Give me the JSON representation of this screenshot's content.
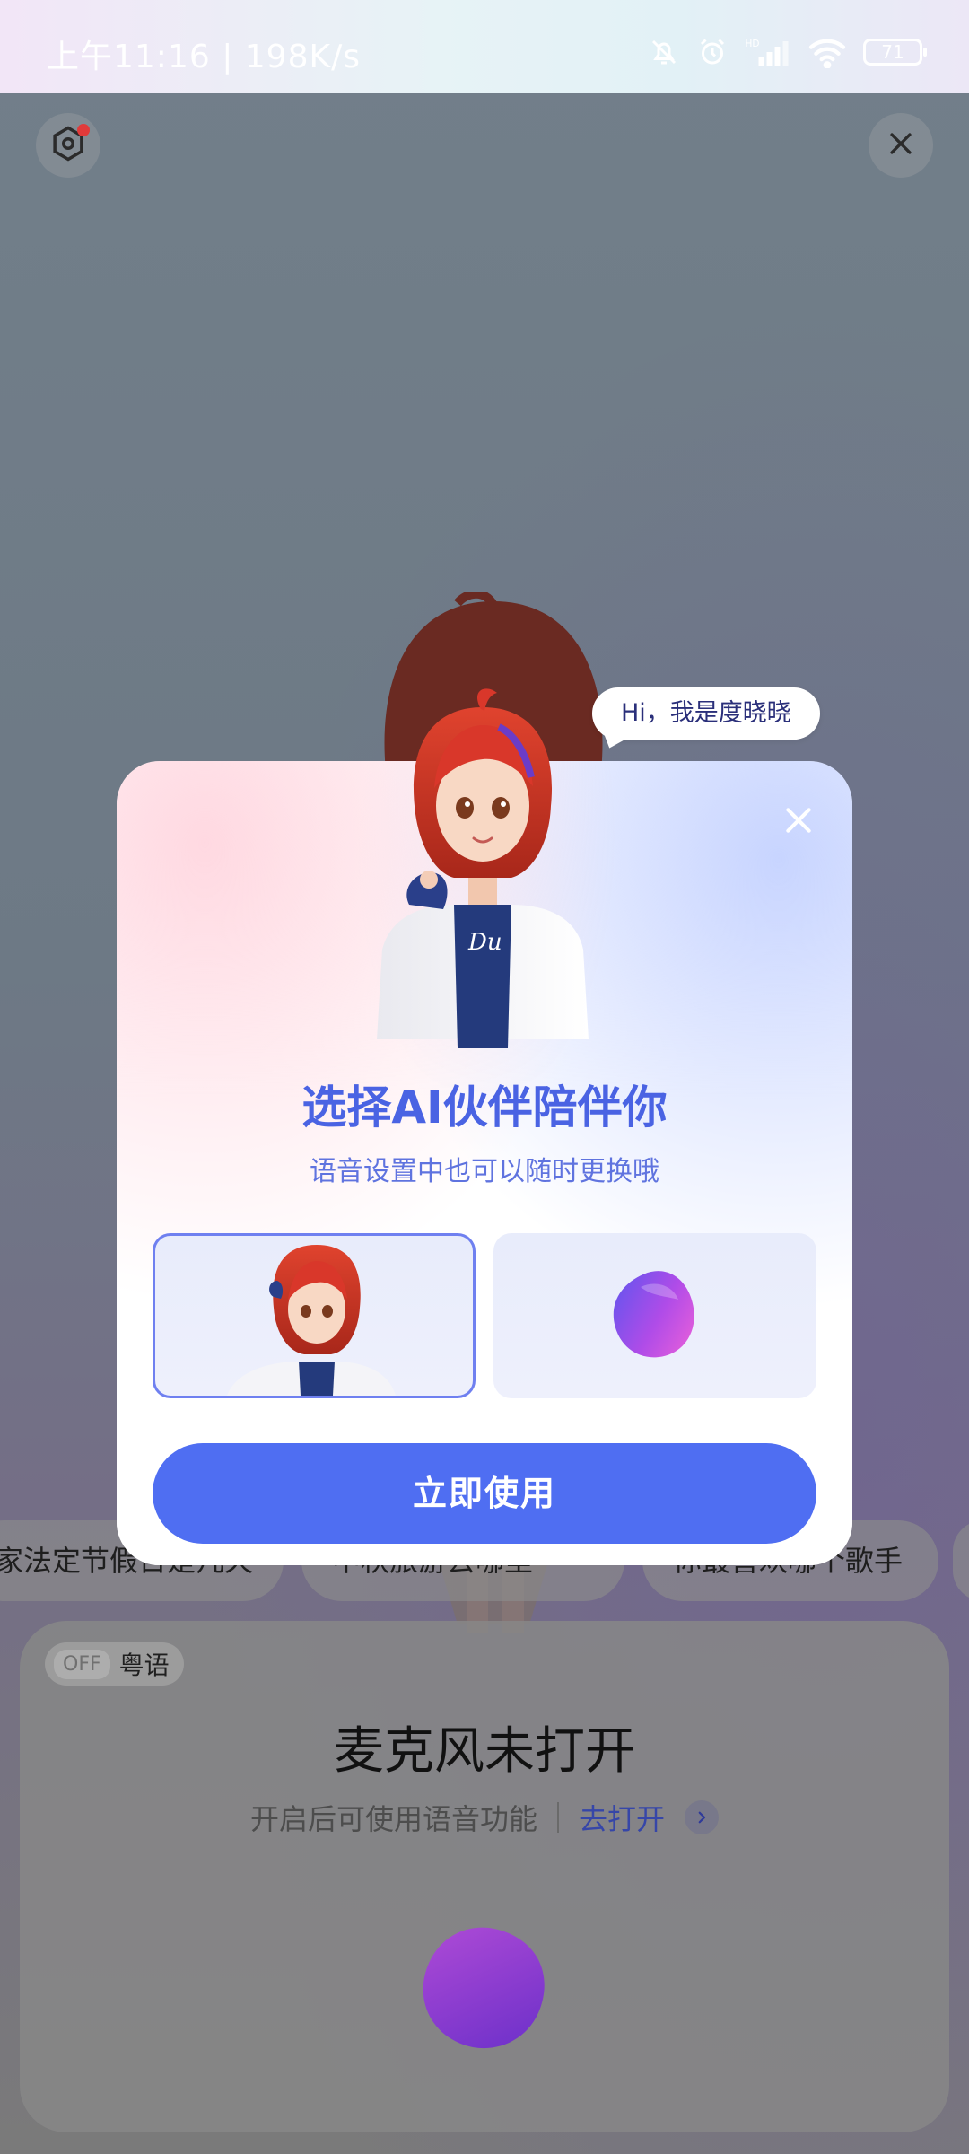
{
  "status_bar": {
    "time_and_speed": "上午11:16 | 198K/s",
    "battery_level": "71",
    "icons": [
      "bell-off-icon",
      "alarm-icon",
      "hd-signal-icon",
      "wifi-icon",
      "battery-icon"
    ]
  },
  "top_bar": {
    "settings_icon": "settings-icon",
    "close_icon": "close-icon"
  },
  "suggestion_chips": [
    "家法定节假日是几天",
    "中秋旅游去哪里",
    "你最喜欢哪个歌手"
  ],
  "bottom_panel": {
    "toggle_state": "OFF",
    "language_label": "粤语",
    "title": "麦克风未打开",
    "subtitle": "开启后可使用语音功能",
    "open_link": "去打开"
  },
  "modal": {
    "speech_bubble": "Hi，我是度晓晓",
    "title": "选择AI伙伴陪伴你",
    "subtitle": "语音设置中也可以随时更换哦",
    "options": [
      {
        "name": "avatar-character",
        "selected": true
      },
      {
        "name": "voice-orb",
        "selected": false
      }
    ],
    "primary_button": "立即使用"
  },
  "colors": {
    "accent": "#4f6ef2",
    "title_blue": "#4a63e3",
    "link_blue": "#3646a8",
    "orb_pink": "#e35ee0",
    "orb_purple": "#7d4ef0"
  }
}
